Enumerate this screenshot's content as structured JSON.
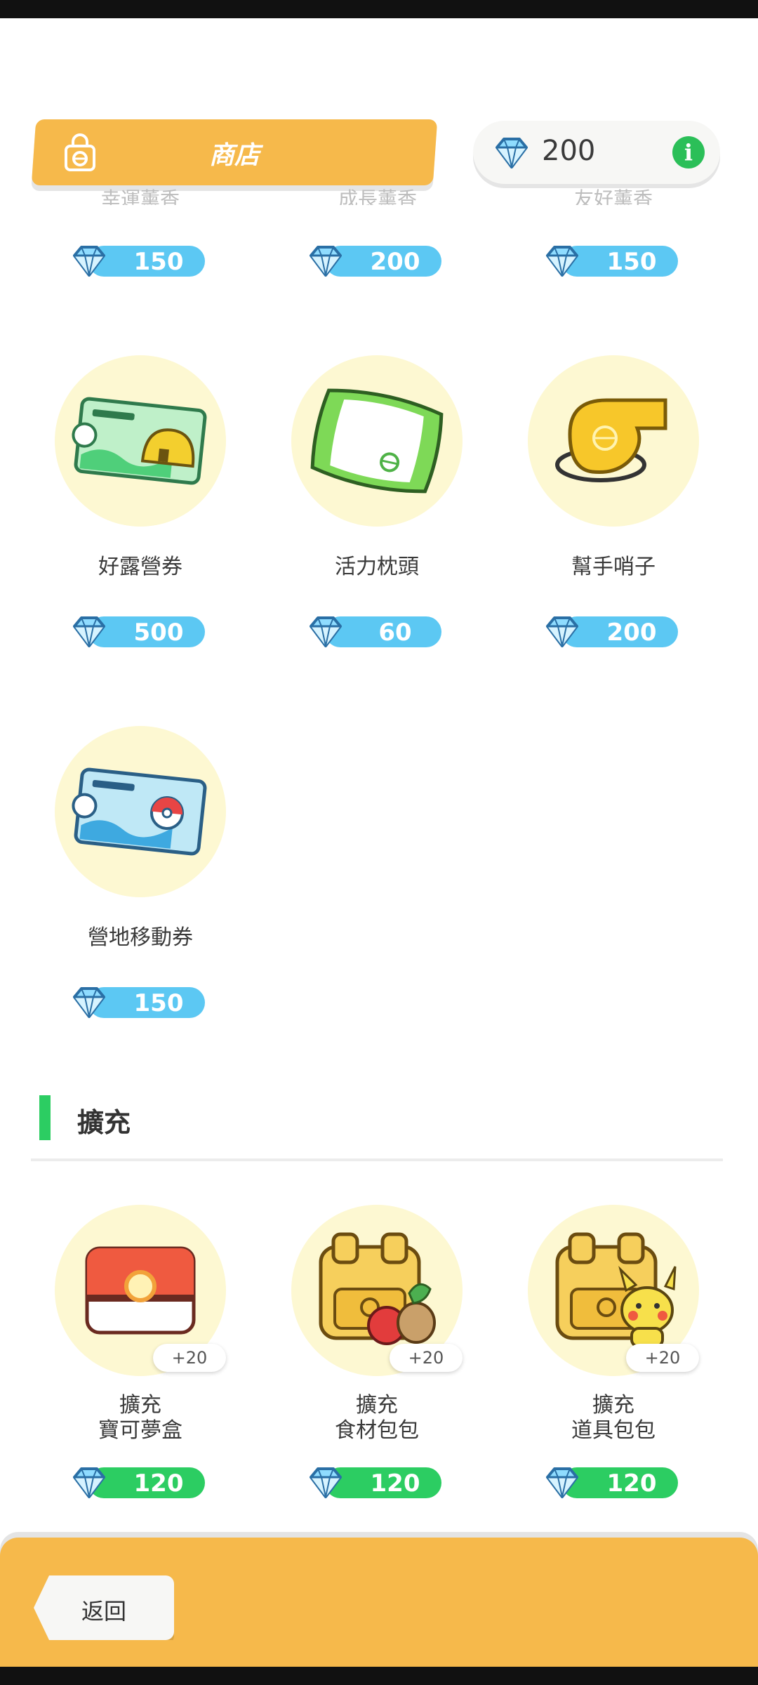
{
  "header": {
    "title": "商店",
    "gem_balance": "200",
    "info_label": "i"
  },
  "faded_row": {
    "items": [
      {
        "name": "幸運薰香",
        "price": "150"
      },
      {
        "name": "成長薰香",
        "price": "200"
      },
      {
        "name": "友好薰香",
        "price": "150"
      }
    ]
  },
  "items_row2": [
    {
      "name": "好露營券",
      "price": "500"
    },
    {
      "name": "活力枕頭",
      "price": "60"
    },
    {
      "name": "幫手哨子",
      "price": "200"
    }
  ],
  "items_row3": [
    {
      "name": "營地移動券",
      "price": "150"
    }
  ],
  "expansion": {
    "section_title": "擴充",
    "items": [
      {
        "name_line1": "擴充",
        "name_line2": "寶可夢盒",
        "badge": "+20",
        "price": "120"
      },
      {
        "name_line1": "擴充",
        "name_line2": "食材包包",
        "badge": "+20",
        "price": "120"
      },
      {
        "name_line1": "擴充",
        "name_line2": "道具包包",
        "badge": "+20",
        "price": "120"
      }
    ]
  },
  "footer": {
    "back_label": "返回"
  },
  "colors": {
    "accent_orange": "#f6b94b",
    "price_blue": "#5cc8f3",
    "price_green": "#2ccd62",
    "item_circle": "#fdf8d2"
  },
  "icons": [
    "shopping-bag-icon",
    "diamond-gem-icon",
    "info-icon",
    "ticket-icon",
    "pillow-icon",
    "whistle-icon",
    "pokemon-box-icon",
    "backpack-icon"
  ]
}
